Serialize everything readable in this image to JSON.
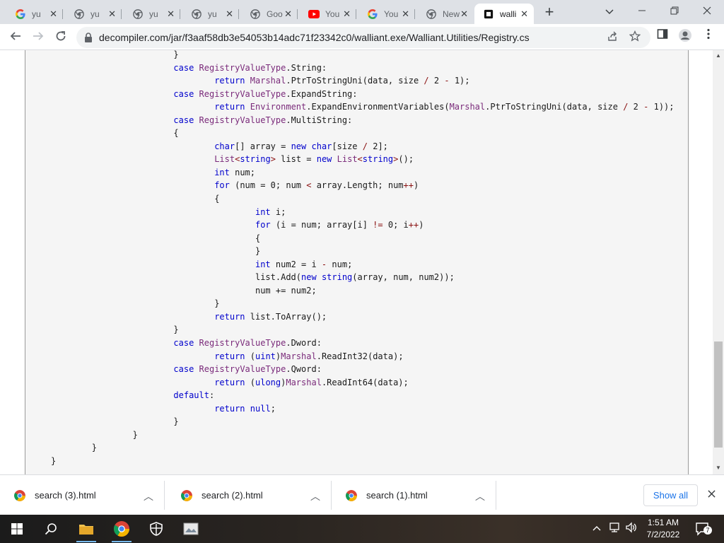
{
  "tabs": [
    {
      "icon": "google-icon",
      "title": "yu",
      "active": false
    },
    {
      "icon": "chrome-icon",
      "title": "yu",
      "active": false
    },
    {
      "icon": "chrome-icon",
      "title": "yu",
      "active": false
    },
    {
      "icon": "chrome-icon",
      "title": "yu",
      "active": false
    },
    {
      "icon": "chrome-icon",
      "title": "Goo",
      "active": false
    },
    {
      "icon": "youtube-icon",
      "title": "You",
      "active": false
    },
    {
      "icon": "google-icon",
      "title": "You",
      "active": false
    },
    {
      "icon": "chrome-icon",
      "title": "New",
      "active": false
    },
    {
      "icon": "decompiler-icon",
      "title": "walli",
      "active": true
    }
  ],
  "address_bar": {
    "url": "decompiler.com/jar/f3aaf58db3e54053b14adc71f23342c0/walliant.exe/Walliant.Utilities/Registry.cs"
  },
  "code_lines": [
    "\t\t\t}",
    "\t\t\tcase RegistryValueType.String:",
    "\t\t\t\treturn Marshal.PtrToStringUni(data, size / 2 - 1);",
    "\t\t\tcase RegistryValueType.ExpandString:",
    "\t\t\t\treturn Environment.ExpandEnvironmentVariables(Marshal.PtrToStringUni(data, size / 2 - 1));",
    "\t\t\tcase RegistryValueType.MultiString:",
    "\t\t\t{",
    "\t\t\t\tchar[] array = new char[size / 2];",
    "\t\t\t\tList<string> list = new List<string>();",
    "\t\t\t\tint num;",
    "\t\t\t\tfor (num = 0; num < array.Length; num++)",
    "\t\t\t\t{",
    "\t\t\t\t\tint i;",
    "\t\t\t\t\tfor (i = num; array[i] != 0; i++)",
    "\t\t\t\t\t{",
    "\t\t\t\t\t}",
    "\t\t\t\t\tint num2 = i - num;",
    "\t\t\t\t\tlist.Add(new string(array, num, num2));",
    "\t\t\t\t\tnum += num2;",
    "\t\t\t\t}",
    "\t\t\t\treturn list.ToArray();",
    "\t\t\t}",
    "\t\t\tcase RegistryValueType.Dword:",
    "\t\t\t\treturn (uint)Marshal.ReadInt32(data);",
    "\t\t\tcase RegistryValueType.Qword:",
    "\t\t\t\treturn (ulong)Marshal.ReadInt64(data);",
    "\t\t\tdefault:",
    "\t\t\t\treturn null;",
    "\t\t\t}",
    "\t\t}",
    "\t}",
    "}"
  ],
  "downloads": [
    {
      "name": "search (3).html"
    },
    {
      "name": "search (2).html"
    },
    {
      "name": "search (1).html"
    }
  ],
  "shelf": {
    "show_all_label": "Show all"
  },
  "taskbar": {
    "time": "1:51 AM",
    "date": "7/2/2022",
    "notification_count": "7"
  }
}
